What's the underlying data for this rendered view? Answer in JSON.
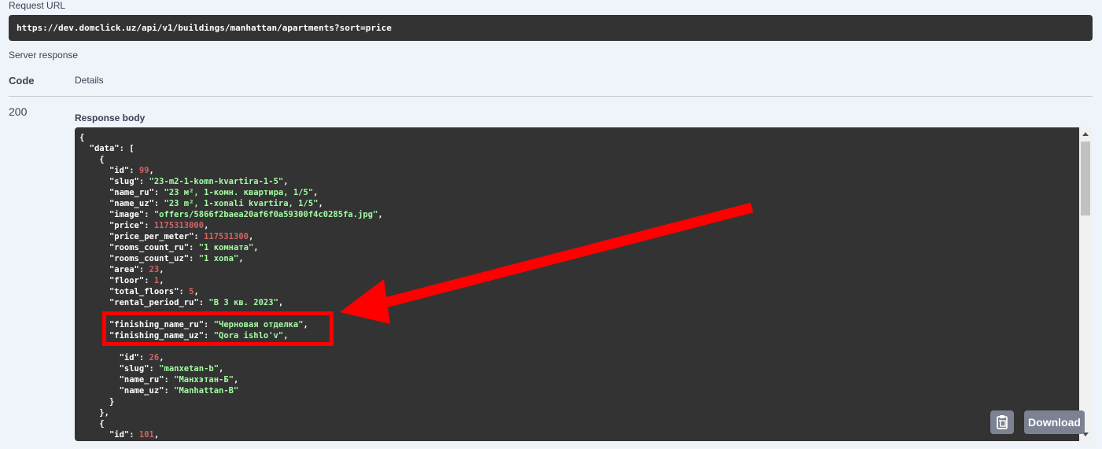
{
  "request": {
    "label": "Request URL",
    "url": "https://dev.domclick.uz/api/v1/buildings/manhattan/apartments?sort=price"
  },
  "server": {
    "label": "Server response",
    "col_code": "Code",
    "col_details": "Details",
    "status_code": "200",
    "body_label": "Response body"
  },
  "response_lines": [
    {
      "indent": 0,
      "parts": [
        {
          "t": "p",
          "v": "{"
        }
      ]
    },
    {
      "indent": 1,
      "parts": [
        {
          "t": "k",
          "v": "\"data\""
        },
        {
          "t": "p",
          "v": ": ["
        }
      ]
    },
    {
      "indent": 2,
      "parts": [
        {
          "t": "p",
          "v": "{"
        }
      ]
    },
    {
      "indent": 3,
      "parts": [
        {
          "t": "k",
          "v": "\"id\""
        },
        {
          "t": "p",
          "v": ": "
        },
        {
          "t": "n",
          "v": "99"
        },
        {
          "t": "p",
          "v": ","
        }
      ]
    },
    {
      "indent": 3,
      "parts": [
        {
          "t": "k",
          "v": "\"slug\""
        },
        {
          "t": "p",
          "v": ": "
        },
        {
          "t": "s",
          "v": "\"23-m2-1-komn-kvartira-1-5\""
        },
        {
          "t": "p",
          "v": ","
        }
      ]
    },
    {
      "indent": 3,
      "parts": [
        {
          "t": "k",
          "v": "\"name_ru\""
        },
        {
          "t": "p",
          "v": ": "
        },
        {
          "t": "s",
          "v": "\"23 м², 1-комн. квартира, 1/5\""
        },
        {
          "t": "p",
          "v": ","
        }
      ]
    },
    {
      "indent": 3,
      "parts": [
        {
          "t": "k",
          "v": "\"name_uz\""
        },
        {
          "t": "p",
          "v": ": "
        },
        {
          "t": "s",
          "v": "\"23 m², 1-xonali kvartira, 1/5\""
        },
        {
          "t": "p",
          "v": ","
        }
      ]
    },
    {
      "indent": 3,
      "parts": [
        {
          "t": "k",
          "v": "\"image\""
        },
        {
          "t": "p",
          "v": ": "
        },
        {
          "t": "s",
          "v": "\"offers/5866f2baea20af6f0a59300f4c0285fa.jpg\""
        },
        {
          "t": "p",
          "v": ","
        }
      ]
    },
    {
      "indent": 3,
      "parts": [
        {
          "t": "k",
          "v": "\"price\""
        },
        {
          "t": "p",
          "v": ": "
        },
        {
          "t": "n",
          "v": "1175313000"
        },
        {
          "t": "p",
          "v": ","
        }
      ]
    },
    {
      "indent": 3,
      "parts": [
        {
          "t": "k",
          "v": "\"price_per_meter\""
        },
        {
          "t": "p",
          "v": ": "
        },
        {
          "t": "n",
          "v": "117531300"
        },
        {
          "t": "p",
          "v": ","
        }
      ]
    },
    {
      "indent": 3,
      "parts": [
        {
          "t": "k",
          "v": "\"rooms_count_ru\""
        },
        {
          "t": "p",
          "v": ": "
        },
        {
          "t": "s",
          "v": "\"1 комната\""
        },
        {
          "t": "p",
          "v": ","
        }
      ]
    },
    {
      "indent": 3,
      "parts": [
        {
          "t": "k",
          "v": "\"rooms_count_uz\""
        },
        {
          "t": "p",
          "v": ": "
        },
        {
          "t": "s",
          "v": "\"1 xona\""
        },
        {
          "t": "p",
          "v": ","
        }
      ]
    },
    {
      "indent": 3,
      "parts": [
        {
          "t": "k",
          "v": "\"area\""
        },
        {
          "t": "p",
          "v": ": "
        },
        {
          "t": "n",
          "v": "23"
        },
        {
          "t": "p",
          "v": ","
        }
      ]
    },
    {
      "indent": 3,
      "parts": [
        {
          "t": "k",
          "v": "\"floor\""
        },
        {
          "t": "p",
          "v": ": "
        },
        {
          "t": "n",
          "v": "1"
        },
        {
          "t": "p",
          "v": ","
        }
      ]
    },
    {
      "indent": 3,
      "parts": [
        {
          "t": "k",
          "v": "\"total_floors\""
        },
        {
          "t": "p",
          "v": ": "
        },
        {
          "t": "n",
          "v": "5"
        },
        {
          "t": "p",
          "v": ","
        }
      ]
    },
    {
      "indent": 3,
      "parts": [
        {
          "t": "k",
          "v": "\"rental_period_ru\""
        },
        {
          "t": "p",
          "v": ": "
        },
        {
          "t": "s",
          "v": "\"В 3 кв. 2023\""
        },
        {
          "t": "p",
          "v": ","
        }
      ]
    },
    {
      "indent": 3,
      "parts": [
        {
          "t": "p",
          "v": ""
        }
      ]
    },
    {
      "indent": 3,
      "parts": [
        {
          "t": "k",
          "v": "\"finishing_name_ru\""
        },
        {
          "t": "p",
          "v": ": "
        },
        {
          "t": "s",
          "v": "\"Черновая отделка\""
        },
        {
          "t": "p",
          "v": ","
        }
      ]
    },
    {
      "indent": 3,
      "parts": [
        {
          "t": "k",
          "v": "\"finishing_name_uz\""
        },
        {
          "t": "p",
          "v": ": "
        },
        {
          "t": "s",
          "v": "\"Qora ishlo'v\""
        },
        {
          "t": "p",
          "v": ","
        }
      ]
    },
    {
      "indent": 3,
      "parts": [
        {
          "t": "p",
          "v": ""
        }
      ]
    },
    {
      "indent": 4,
      "parts": [
        {
          "t": "k",
          "v": "\"id\""
        },
        {
          "t": "p",
          "v": ": "
        },
        {
          "t": "n",
          "v": "26"
        },
        {
          "t": "p",
          "v": ","
        }
      ]
    },
    {
      "indent": 4,
      "parts": [
        {
          "t": "k",
          "v": "\"slug\""
        },
        {
          "t": "p",
          "v": ": "
        },
        {
          "t": "s",
          "v": "\"manxetan-b\""
        },
        {
          "t": "p",
          "v": ","
        }
      ]
    },
    {
      "indent": 4,
      "parts": [
        {
          "t": "k",
          "v": "\"name_ru\""
        },
        {
          "t": "p",
          "v": ": "
        },
        {
          "t": "s",
          "v": "\"Манхэтан-Б\""
        },
        {
          "t": "p",
          "v": ","
        }
      ]
    },
    {
      "indent": 4,
      "parts": [
        {
          "t": "k",
          "v": "\"name_uz\""
        },
        {
          "t": "p",
          "v": ": "
        },
        {
          "t": "s",
          "v": "\"Manhattan-B\""
        }
      ]
    },
    {
      "indent": 3,
      "parts": [
        {
          "t": "p",
          "v": "}"
        }
      ]
    },
    {
      "indent": 2,
      "parts": [
        {
          "t": "p",
          "v": "},"
        }
      ]
    },
    {
      "indent": 2,
      "parts": [
        {
          "t": "p",
          "v": "{"
        }
      ]
    },
    {
      "indent": 3,
      "parts": [
        {
          "t": "k",
          "v": "\"id\""
        },
        {
          "t": "p",
          "v": ": "
        },
        {
          "t": "n",
          "v": "101"
        },
        {
          "t": "p",
          "v": ","
        }
      ]
    }
  ],
  "buttons": {
    "download_label": "Download",
    "copy_icon": "clipboard-icon"
  },
  "annotation": {
    "color": "#ff0000"
  },
  "colors": {
    "page_bg": "#eef4fa",
    "code_bg": "#333333",
    "string": "#a2fca2",
    "number": "#d36363",
    "button_bg": "#7d8293"
  }
}
